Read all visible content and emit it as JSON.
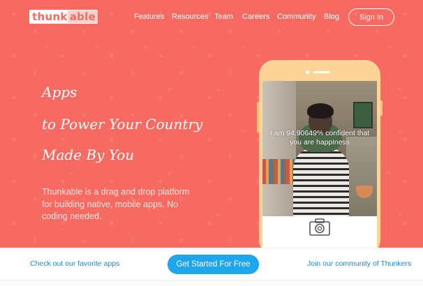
{
  "header": {
    "logo_main": "thunk",
    "logo_tail": "able",
    "nav": [
      {
        "label": "Features"
      },
      {
        "label": "Resources"
      },
      {
        "label": "Team"
      },
      {
        "label": "Careers"
      },
      {
        "label": "Community"
      },
      {
        "label": "Blog"
      }
    ],
    "signin_label": "Sign In"
  },
  "hero": {
    "headline": [
      "Apps",
      "to Power Your Country",
      "Made By You"
    ],
    "tagline": "Thunkable is a drag and drop platform for building native, mobile apps. No coding needed."
  },
  "phone": {
    "overlay_line1": "I am 94.90649% confident that",
    "overlay_line2": "you are happiness",
    "camera_icon": "camera-icon"
  },
  "bottom_bar": {
    "left_link": "Check out our favorite apps",
    "cta_label": "Get Started For Free",
    "right_link": "Join our community of Thunkers"
  },
  "colors": {
    "hero_bg": "#f76a62",
    "phone_body": "#fdd497",
    "cta_bg": "#1ea5ec",
    "link": "#1f87c4"
  }
}
